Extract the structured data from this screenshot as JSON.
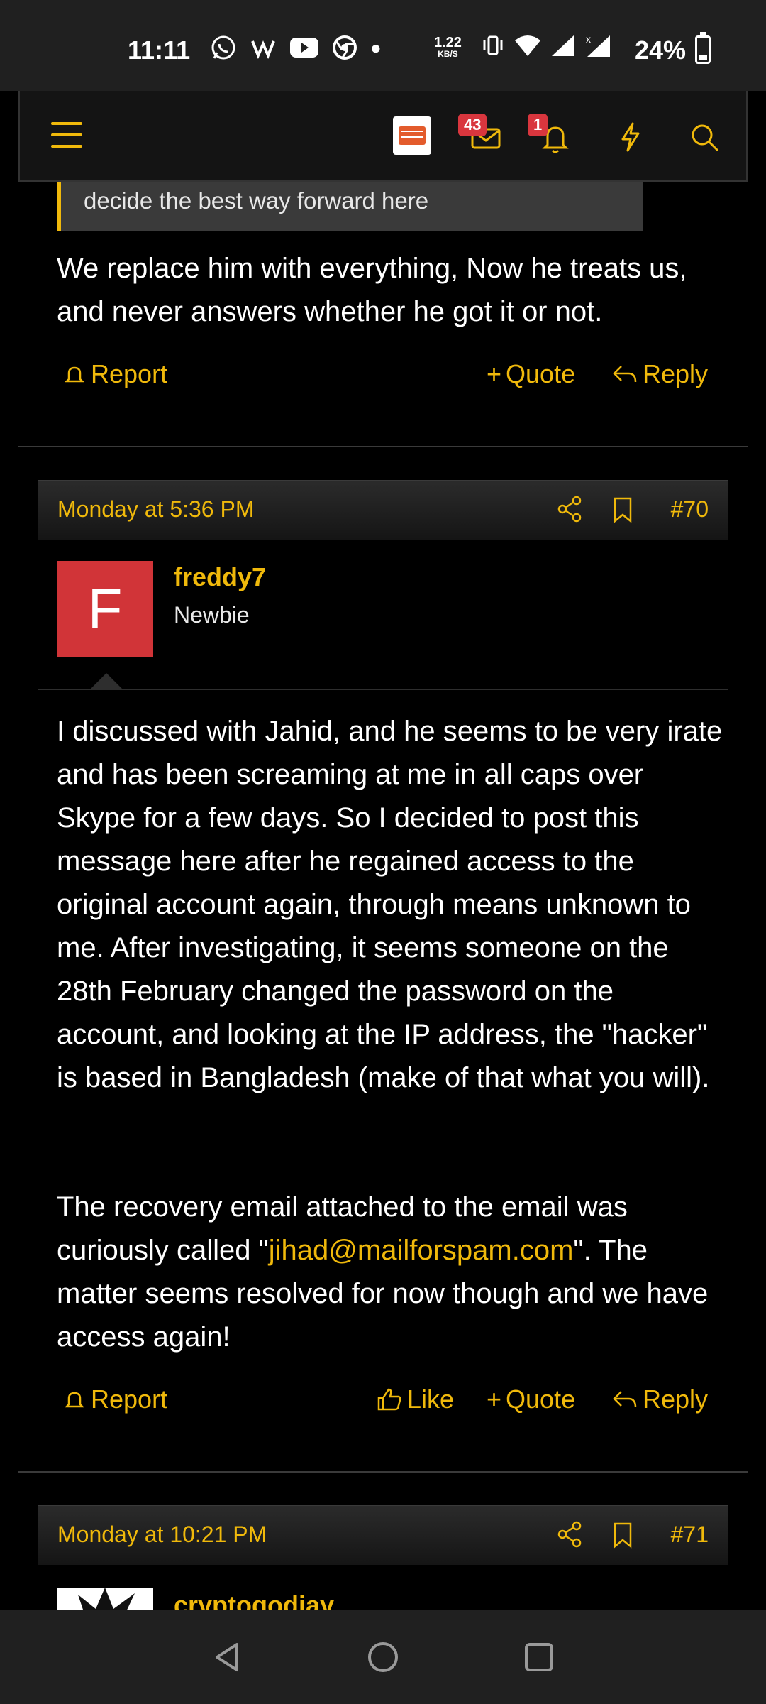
{
  "status": {
    "time": "11:11",
    "net_speed_value": "1.22",
    "net_speed_unit": "KB/S",
    "battery": "24%",
    "battery_level": 0.24
  },
  "header": {
    "messages_badge": "43",
    "alerts_badge": "1"
  },
  "prev_post": {
    "quote_text": "decide the best way forward here",
    "body": "We replace him with everything, Now he treats us, and never answers whether he got it or not.",
    "actions": {
      "report": "Report",
      "quote": "Quote",
      "reply": "Reply"
    }
  },
  "post70": {
    "date": "Monday at 5:36 PM",
    "number": "#70",
    "avatar_letter": "F",
    "username": "freddy7",
    "user_title": "Newbie",
    "para1": "I discussed with Jahid, and he seems to be very irate and has been screaming at me in all caps over Skype for a few days. So I decided to post this message here after he regained access to the original account again, through means unknown to me. After investigating, it seems someone on the 28th February changed the password on the account, and looking at the IP address, the \"hacker\" is based in Bangladesh (make of that what you will).",
    "para2_before": "The recovery email attached to the email was curiously called \"",
    "para2_link": "jihad@mailforspam.com",
    "para2_after": "\". The matter seems resolved for now though and we have access again!",
    "actions": {
      "report": "Report",
      "like": "Like",
      "quote": "Quote",
      "reply": "Reply"
    }
  },
  "post71": {
    "date": "Monday at 10:21 PM",
    "number": "#71",
    "username": "cryptogodjay"
  },
  "colors": {
    "accent": "#f0b90b",
    "badge": "#d9363e",
    "avatar": "#d13438"
  }
}
